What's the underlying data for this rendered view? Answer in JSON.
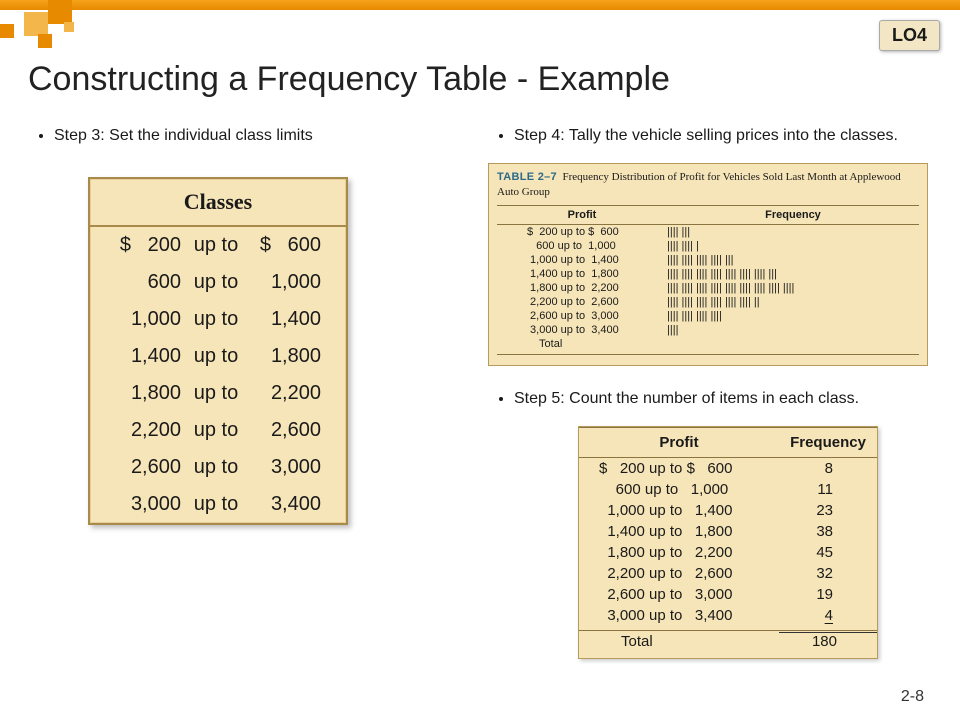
{
  "badge": "LO4",
  "title": "Constructing a Frequency Table - Example",
  "step3": "Step 3: Set the individual class limits",
  "step4": "Step 4: Tally the vehicle selling prices into the classes.",
  "step5": "Step 5: Count the number of items in each class.",
  "page": "2-8",
  "classes_header": "Classes",
  "classes": [
    {
      "l": "$   200",
      "m": "up to",
      "r": "$   600"
    },
    {
      "l": "600",
      "m": "up to",
      "r": "1,000"
    },
    {
      "l": "1,000",
      "m": "up to",
      "r": "1,400"
    },
    {
      "l": "1,400",
      "m": "up to",
      "r": "1,800"
    },
    {
      "l": "1,800",
      "m": "up to",
      "r": "2,200"
    },
    {
      "l": "2,200",
      "m": "up to",
      "r": "2,600"
    },
    {
      "l": "2,600",
      "m": "up to",
      "r": "3,000"
    },
    {
      "l": "3,000",
      "m": "up to",
      "r": "3,400"
    }
  ],
  "t27": {
    "label": "TABLE 2–7",
    "caption": "Frequency Distribution of Profit for Vehicles Sold Last Month at Applewood Auto Group",
    "h1": "Profit",
    "h2": "Frequency",
    "rows": [
      {
        "p": "$  200 up to $  600",
        "t": "|||| |||"
      },
      {
        "p": "   600 up to  1,000",
        "t": "|||| |||| |"
      },
      {
        "p": " 1,000 up to  1,400",
        "t": "|||| |||| |||| |||| |||"
      },
      {
        "p": " 1,400 up to  1,800",
        "t": "|||| |||| |||| |||| |||| |||| |||| |||"
      },
      {
        "p": " 1,800 up to  2,200",
        "t": "|||| |||| |||| |||| |||| |||| |||| |||| ||||"
      },
      {
        "p": " 2,200 up to  2,600",
        "t": "|||| |||| |||| |||| |||| |||| ||"
      },
      {
        "p": " 2,600 up to  3,000",
        "t": "|||| |||| |||| ||||"
      },
      {
        "p": " 3,000 up to  3,400",
        "t": "||||"
      }
    ],
    "total": "    Total"
  },
  "pf": {
    "h1": "Profit",
    "h2": "Frequency",
    "rows": [
      {
        "p": "$   200 up to $   600",
        "f": "8"
      },
      {
        "p": "    600 up to   1,000",
        "f": "11"
      },
      {
        "p": "  1,000 up to   1,400",
        "f": "23"
      },
      {
        "p": "  1,400 up to   1,800",
        "f": "38"
      },
      {
        "p": "  1,800 up to   2,200",
        "f": "45"
      },
      {
        "p": "  2,200 up to   2,600",
        "f": "32"
      },
      {
        "p": "  2,600 up to   3,000",
        "f": "19"
      },
      {
        "p": "  3,000 up to   3,400",
        "f": "4"
      }
    ],
    "total_label": "  Total",
    "total_value": "180"
  },
  "chart_data": {
    "type": "table",
    "title": "Frequency Distribution of Profit for Vehicles Sold Last Month at Applewood Auto Group",
    "columns": [
      "Profit ($)",
      "Frequency"
    ],
    "bin_width": 400,
    "bins": [
      {
        "low": 200,
        "high": 600,
        "frequency": 8
      },
      {
        "low": 600,
        "high": 1000,
        "frequency": 11
      },
      {
        "low": 1000,
        "high": 1400,
        "frequency": 23
      },
      {
        "low": 1400,
        "high": 1800,
        "frequency": 38
      },
      {
        "low": 1800,
        "high": 2200,
        "frequency": 45
      },
      {
        "low": 2200,
        "high": 2600,
        "frequency": 32
      },
      {
        "low": 2600,
        "high": 3000,
        "frequency": 19
      },
      {
        "low": 3000,
        "high": 3400,
        "frequency": 4
      }
    ],
    "total": 180
  }
}
